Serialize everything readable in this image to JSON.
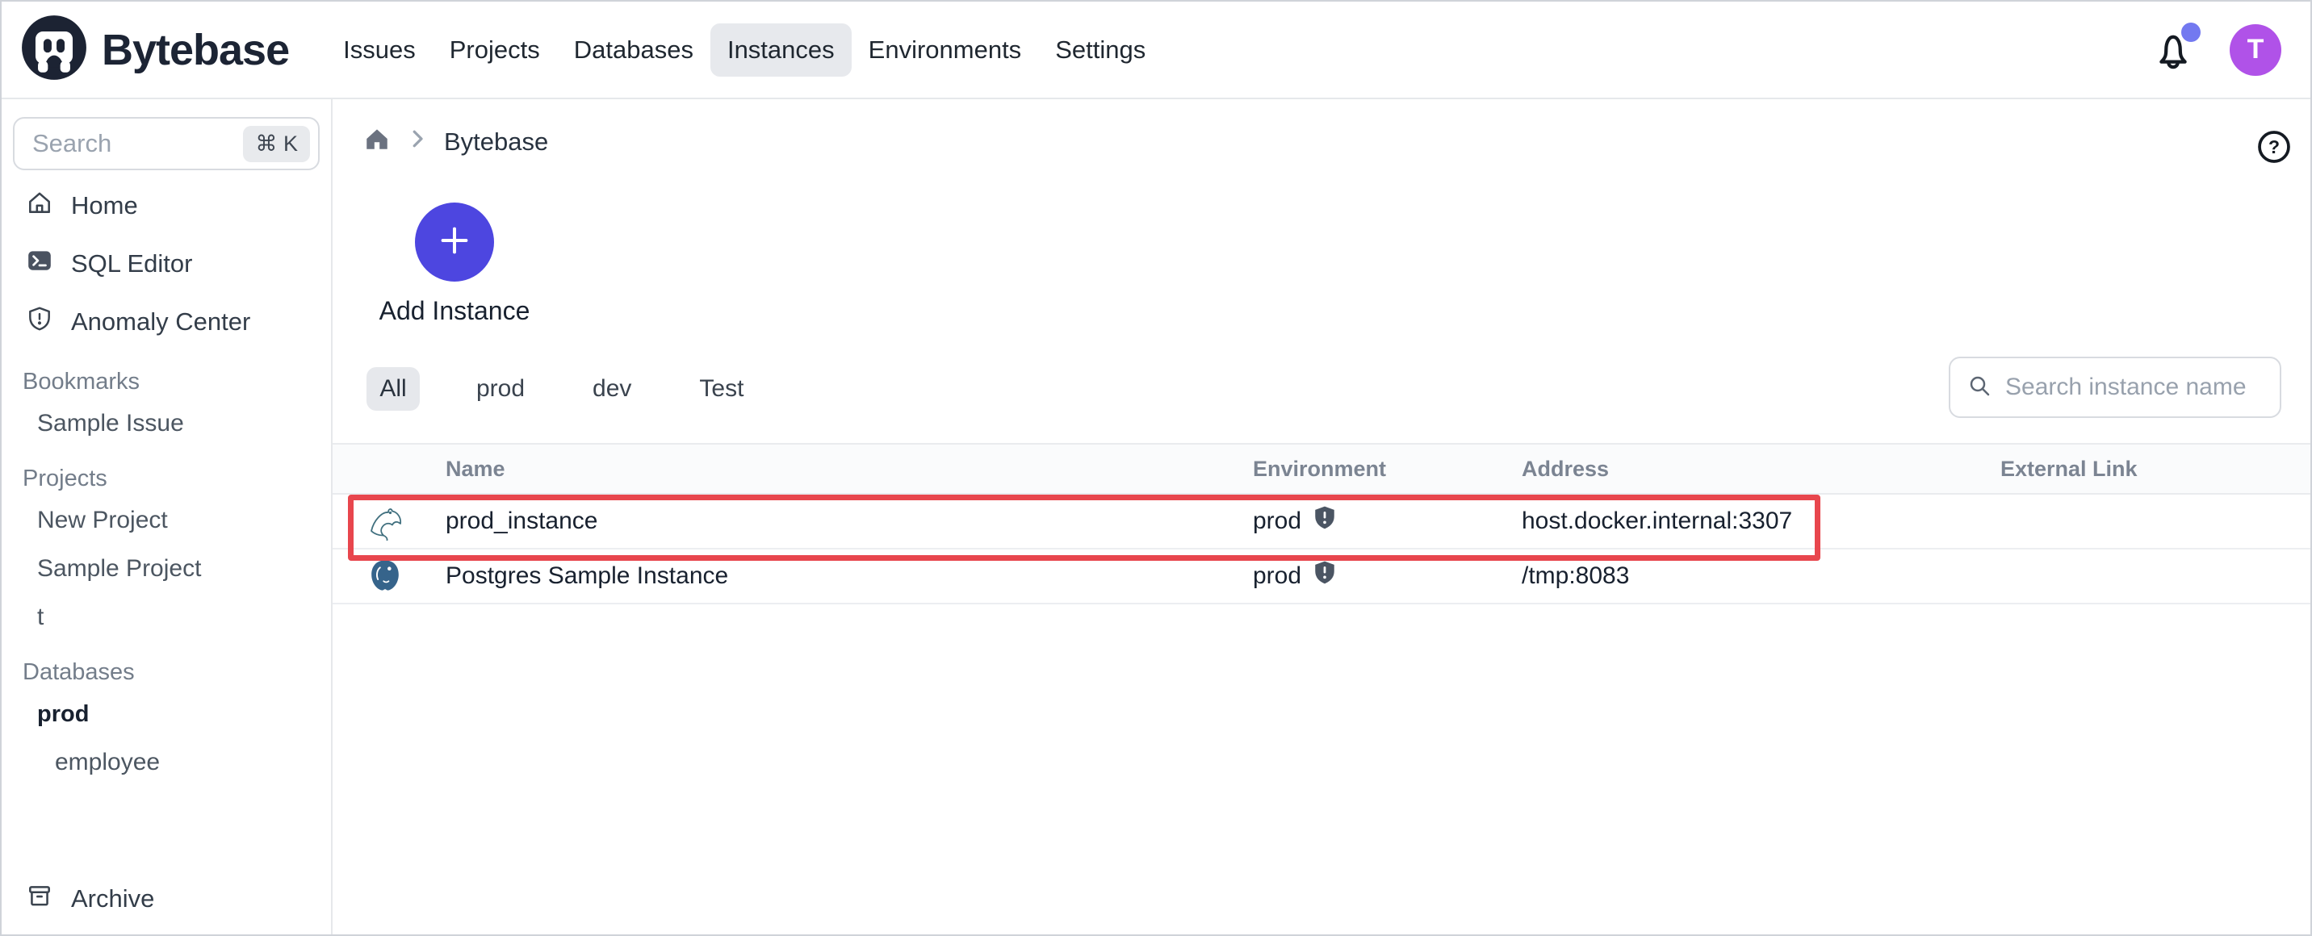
{
  "header": {
    "brand": "Bytebase",
    "nav": [
      {
        "label": "Issues",
        "active": false
      },
      {
        "label": "Projects",
        "active": false
      },
      {
        "label": "Databases",
        "active": false
      },
      {
        "label": "Instances",
        "active": true
      },
      {
        "label": "Environments",
        "active": false
      },
      {
        "label": "Settings",
        "active": false
      }
    ],
    "avatar_initial": "T"
  },
  "sidebar": {
    "search_placeholder": "Search",
    "search_shortcut": "⌘ K",
    "items": [
      {
        "label": "Home",
        "icon": "home-icon"
      },
      {
        "label": "SQL Editor",
        "icon": "terminal-icon"
      },
      {
        "label": "Anomaly Center",
        "icon": "shield-alert-icon"
      }
    ],
    "sections": [
      {
        "label": "Bookmarks"
      },
      {
        "label": "Projects"
      },
      {
        "label": "Databases"
      }
    ],
    "bookmarks": [
      {
        "label": "Sample Issue"
      }
    ],
    "projects": [
      {
        "label": "New Project"
      },
      {
        "label": "Sample Project"
      },
      {
        "label": "t"
      }
    ],
    "databases": [
      {
        "label": "prod"
      },
      {
        "label": "employee"
      }
    ],
    "archive_label": "Archive"
  },
  "main": {
    "breadcrumb": {
      "current": "Bytebase"
    },
    "help_glyph": "?",
    "add_instance_label": "Add Instance",
    "filters": [
      {
        "label": "All",
        "active": true
      },
      {
        "label": "prod",
        "active": false
      },
      {
        "label": "dev",
        "active": false
      },
      {
        "label": "Test",
        "active": false
      }
    ],
    "search_placeholder": "Search instance name",
    "table": {
      "columns": [
        {
          "label": "Name"
        },
        {
          "label": "Environment"
        },
        {
          "label": "Address"
        },
        {
          "label": "External Link"
        }
      ],
      "rows": [
        {
          "engine_icon": "mysql-icon",
          "name": "prod_instance",
          "environment": "prod",
          "address": "host.docker.internal:3307",
          "external_link": "",
          "highlighted": true
        },
        {
          "engine_icon": "postgres-icon",
          "name": "Postgres Sample Instance",
          "environment": "prod",
          "address": "/tmp:8083",
          "external_link": "",
          "highlighted": false
        }
      ]
    },
    "annotation": {
      "type": "highlight-box",
      "target_row": "prod_instance",
      "color": "#e8464d"
    }
  },
  "colors": {
    "accent_indigo": "#4d46e0",
    "highlight_red": "#e8464d",
    "avatar_purple": "#b052e8",
    "notification_dot": "#7379f0",
    "brand_navy": "#1c2434"
  }
}
